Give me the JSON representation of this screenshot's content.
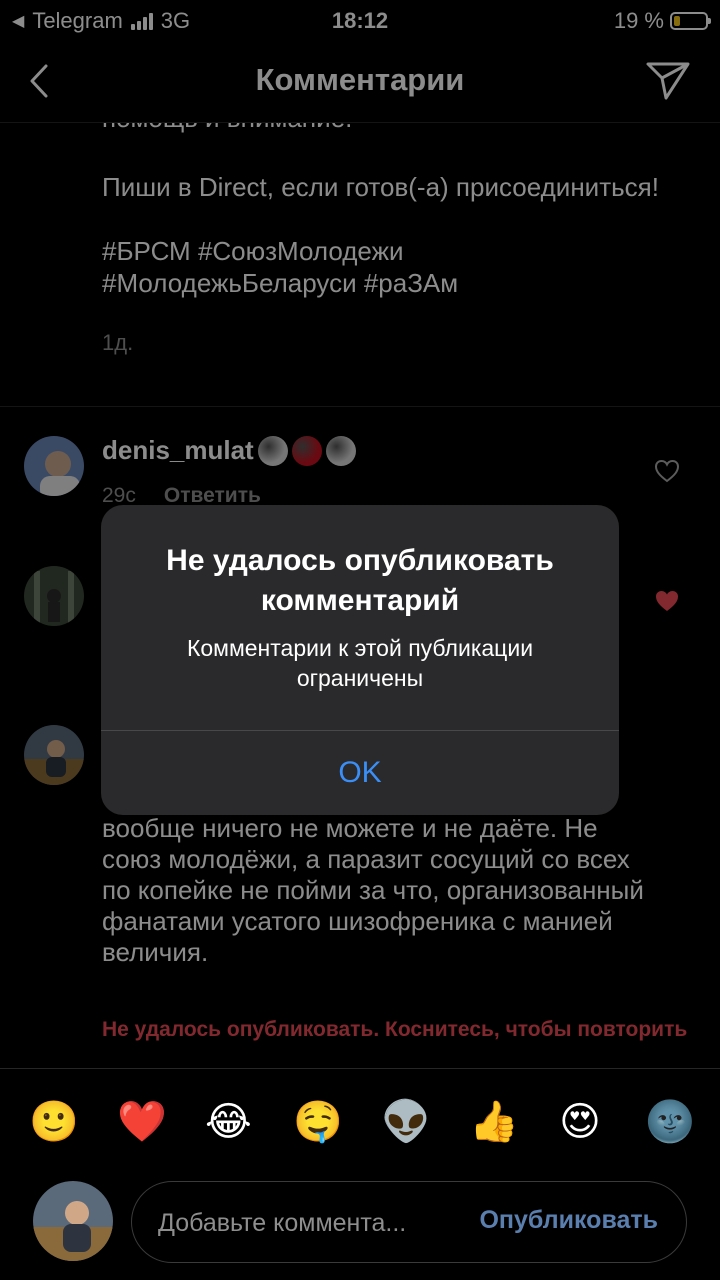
{
  "status_bar": {
    "back_app": "Telegram",
    "network": "3G",
    "time": "18:12",
    "battery_percent": "19 %",
    "battery_level": 0.19
  },
  "header": {
    "title": "Комментарии"
  },
  "post": {
    "caption_cut_line": "помощь и внимание.",
    "caption_paragraph1": "Пиши в Direct, если готов(-а) присоединиться!",
    "caption_hashtags": "#БРСМ #СоюзМолодежи #МолодежьБеларуси #раЗАм",
    "caption_time": "1д."
  },
  "comments": [
    {
      "username": "denis_mulat",
      "emoji_colors": [
        "#d8d8d8",
        "#c1121f",
        "#d8d8d8"
      ],
      "time": "29с",
      "reply_label": "Ответить"
    }
  ],
  "draft_comment": {
    "text": "вообще ничего не можете и не даёте. Не союз молодёжи, а паразит сосущий со всех по копейке не пойми за что, организованный фанатами усатого шизофреника с манией величия.",
    "error": "Не удалось опубликовать. Коснитесь, чтобы повторить"
  },
  "alert": {
    "title": "Не удалось опубликовать комментарий",
    "message": "Комментарии к этой публикации ограничены",
    "ok_label": "OK"
  },
  "emoji_bar": [
    "🙂",
    "❤️",
    "😂",
    "🤤",
    "👽",
    "👍",
    "😍",
    "🌚"
  ],
  "comment_input": {
    "placeholder": "Добавьте коммента...",
    "publish_label": "Опубликовать"
  },
  "colors": {
    "error_red": "#ed4956",
    "alert_button_blue": "#3a8ef6",
    "liked_heart": "#ed4956"
  }
}
